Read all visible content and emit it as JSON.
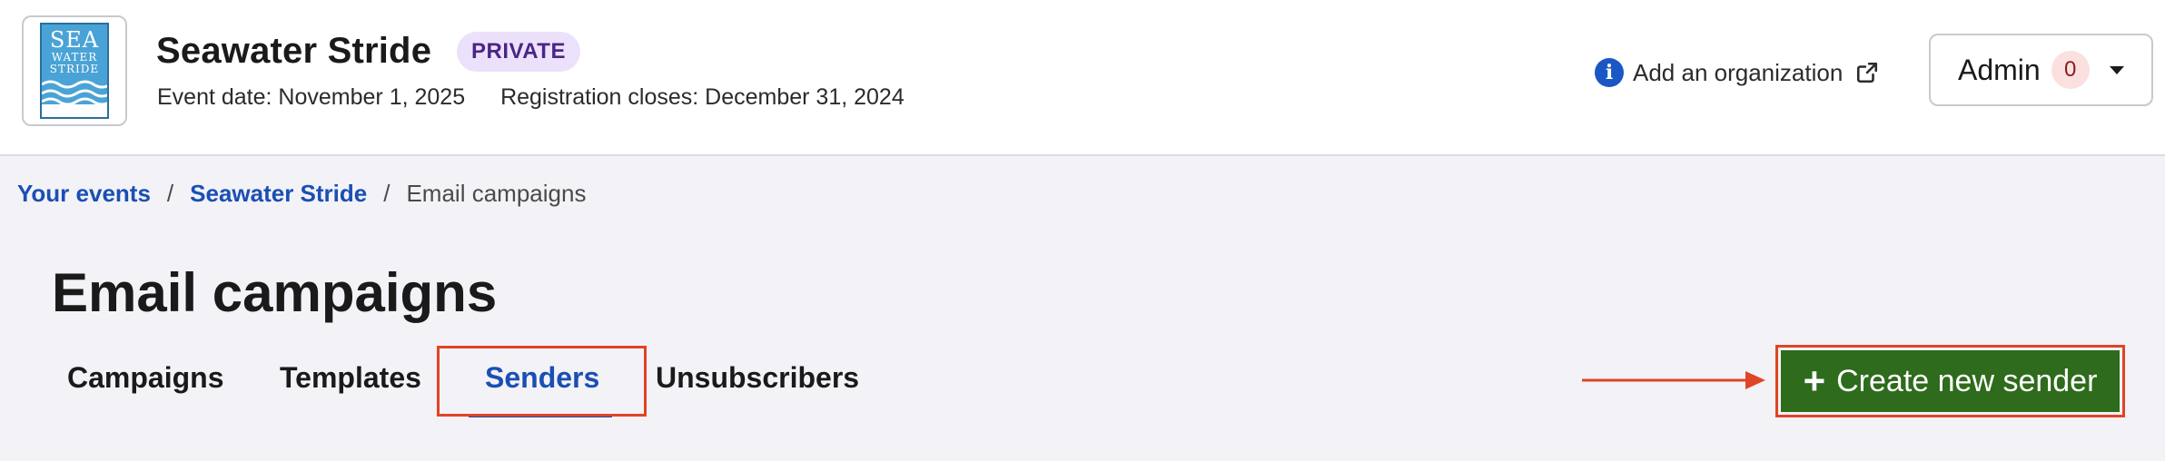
{
  "header": {
    "logo": {
      "line1": "SEA",
      "line2": "WATER",
      "line3": "STRIDE"
    },
    "event_title": "Seawater Stride",
    "badge": "PRIVATE",
    "event_date": "Event date: November 1, 2025",
    "registration_closes": "Registration closes: December 31, 2024",
    "add_org_label": "Add an organization",
    "admin_label": "Admin",
    "admin_count": "0"
  },
  "breadcrumb": {
    "items": [
      {
        "label": "Your events"
      },
      {
        "label": "Seawater Stride"
      },
      {
        "label": "Email campaigns"
      }
    ],
    "separator": "/"
  },
  "page": {
    "title": "Email campaigns",
    "tabs": [
      {
        "label": "Campaigns",
        "active": false
      },
      {
        "label": "Templates",
        "active": false
      },
      {
        "label": "Senders",
        "active": true
      },
      {
        "label": "Unsubscribers",
        "active": false
      }
    ],
    "create_button_label": "Create new sender"
  },
  "colors": {
    "accent_blue": "#1a4fb4",
    "primary_green": "#2e6b1c",
    "highlight_red": "#e04426",
    "badge_bg": "#ece1fb"
  },
  "icons": [
    "info-icon",
    "external-link-icon",
    "caret-down-icon",
    "plus-icon",
    "arrow-right-icon"
  ]
}
